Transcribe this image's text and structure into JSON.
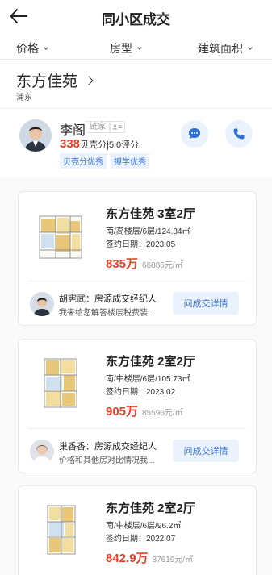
{
  "header": {
    "title": "同小区成交"
  },
  "filters": [
    {
      "label": "价格"
    },
    {
      "label": "房型"
    },
    {
      "label": "建筑面积"
    }
  ],
  "community": {
    "name": "东方佳苑",
    "district": "浦东"
  },
  "agent": {
    "name": "李阁",
    "company": "链家",
    "score_num": "338",
    "score_text": "贝壳分|5.0评分",
    "tags": [
      "贝壳分优秀",
      "搏学优秀"
    ]
  },
  "deals": [
    {
      "title": "东方佳苑 3室2厅",
      "info": "南/高楼层/6层/124.84㎡",
      "date": "签约日期：2023.05",
      "price": "835万",
      "unit_price": "66886元/㎡",
      "agent_name": "胡宪武：房源成交经纪人",
      "agent_desc": "我来给您解答楼层税费装...",
      "button": "问成交详情"
    },
    {
      "title": "东方佳苑 2室2厅",
      "info": "南/中楼层/6层/105.73㎡",
      "date": "签约日期：2023.02",
      "price": "905万",
      "unit_price": "85596元/㎡",
      "agent_name": "巢香香：房源成交经纪人",
      "agent_desc": "价格和其他房对比情况我...",
      "button": "问成交详情"
    },
    {
      "title": "东方佳苑 2室2厅",
      "info": "南/中楼层/6层/96.2㎡",
      "date": "签约日期：2022.07",
      "price": "842.9万",
      "unit_price": "87619元/㎡"
    }
  ],
  "colors": {
    "accent": "#3a75d6",
    "price": "#e8412b",
    "tag_bg": "#eaf2fd"
  }
}
